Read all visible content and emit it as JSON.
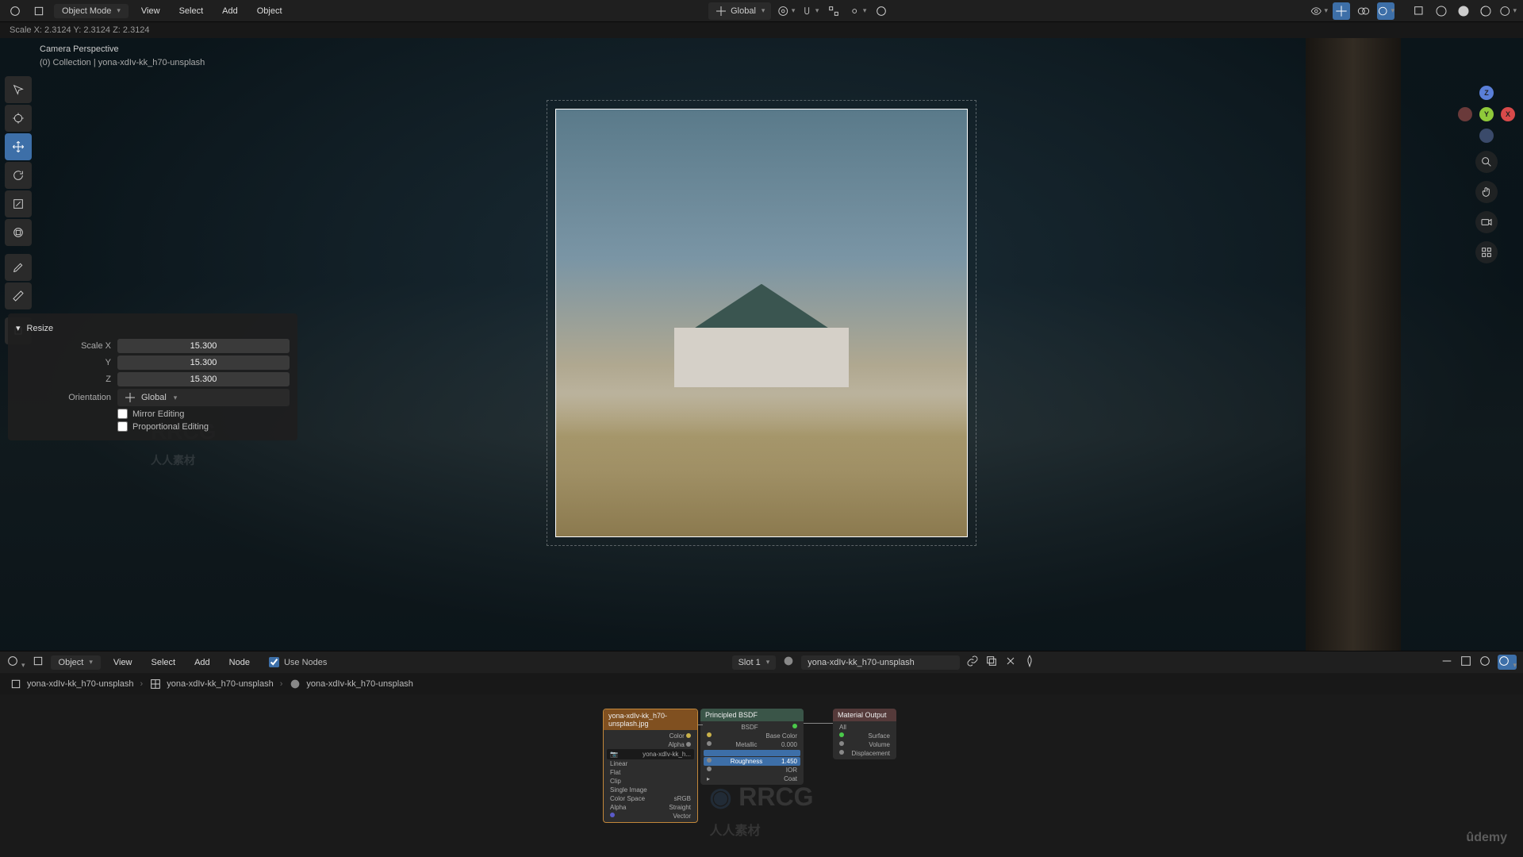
{
  "top": {
    "mode": "Object Mode",
    "menus": [
      "View",
      "Select",
      "Add",
      "Object"
    ],
    "orientation": "Global"
  },
  "status_text": "Scale X: 2.3124   Y: 2.3124   Z: 2.3124",
  "viewport": {
    "title": "Camera Perspective",
    "collection": "(0) Collection | yona-xdIv-kk_h70-unsplash"
  },
  "operator": {
    "title": "Resize",
    "rows": [
      {
        "label": "Scale X",
        "value": "15.300"
      },
      {
        "label": "Y",
        "value": "15.300"
      },
      {
        "label": "Z",
        "value": "15.300"
      }
    ],
    "orientation_label": "Orientation",
    "orientation_value": "Global",
    "mirror_label": "Mirror Editing",
    "prop_label": "Proportional Editing"
  },
  "node_header": {
    "mode": "Object",
    "menus": [
      "View",
      "Select",
      "Add",
      "Node"
    ],
    "use_nodes": "Use Nodes",
    "slot": "Slot 1",
    "material": "yona-xdIv-kk_h70-unsplash"
  },
  "breadcrumb": {
    "items": [
      "yona-xdIv-kk_h70-unsplash",
      "yona-xdIv-kk_h70-unsplash",
      "yona-xdIv-kk_h70-unsplash"
    ]
  },
  "nodes": {
    "image": {
      "title": "yona-xdIv-kk_h70-unsplash.jpg",
      "name": "yona-xdIv-kk_h...",
      "interp": "Linear",
      "proj": "Flat",
      "ext": "Clip",
      "source": "Single Image",
      "colorspace_l": "Color Space",
      "colorspace_v": "sRGB",
      "alpha_l": "Alpha",
      "alpha_v": "Straight",
      "vector": "Vector"
    },
    "bsdf": {
      "title": "Principled BSDF",
      "out": "BSDF",
      "base_l": "Base Color",
      "metal_l": "Metallic",
      "metal_v": "0.000",
      "rough_l": "Roughness",
      "rough_v": "1.450",
      "ior_l": "IOR",
      "coat_l": "Coat"
    },
    "output": {
      "title": "Material Output",
      "all": "All",
      "surface": "Surface",
      "volume": "Volume",
      "disp": "Displacement"
    }
  },
  "gizmo": {
    "z": "Z",
    "y": "Y",
    "x": "X"
  },
  "wm": {
    "brand": "RRCG",
    "sub": "人人素材",
    "udemy": "ûdemy"
  }
}
